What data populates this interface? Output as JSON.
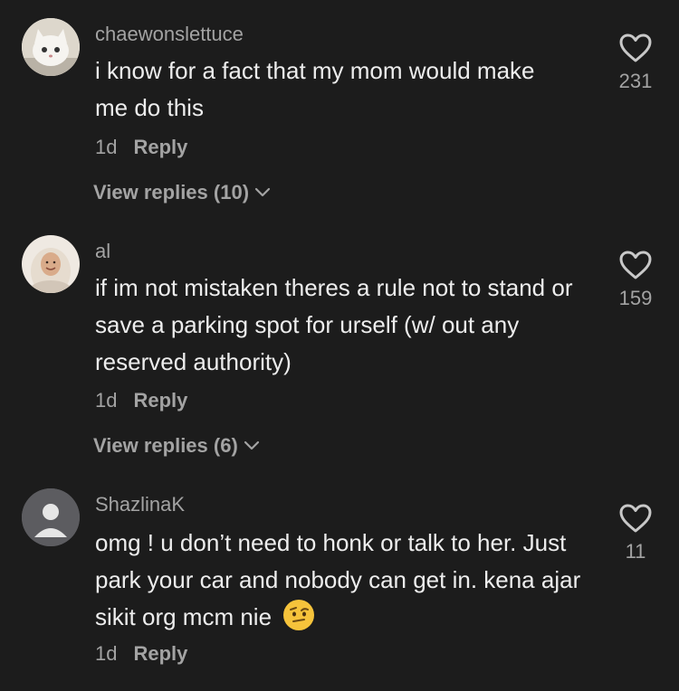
{
  "comments": [
    {
      "username": "chaewonslettuce",
      "text": "i know for a fact that my mom would make me do this",
      "time": "1d",
      "reply_label": "Reply",
      "view_replies": "View replies (10)",
      "likes": "231",
      "avatar": "white-cat-avatar"
    },
    {
      "username": "al",
      "text": "if im not mistaken theres a rule not to stand or save a parking spot for urself (w/ out any reserved authority)",
      "time": "1d",
      "reply_label": "Reply",
      "view_replies": "View replies (6)",
      "likes": "159",
      "avatar": "person-hijab-avatar"
    },
    {
      "username": "ShazlinaK",
      "text": "omg ! u don’t need to honk or talk to her. Just park your car and nobody can get in. kena ajar sikit org mcm nie",
      "time": "1d",
      "reply_label": "Reply",
      "likes": "11",
      "avatar": "default-user-avatar",
      "emoji": "raised-eyebrow-emoji"
    }
  ],
  "colors": {
    "background": "#1c1c1c",
    "muted": "#a3a3a3",
    "text": "#ededed"
  }
}
